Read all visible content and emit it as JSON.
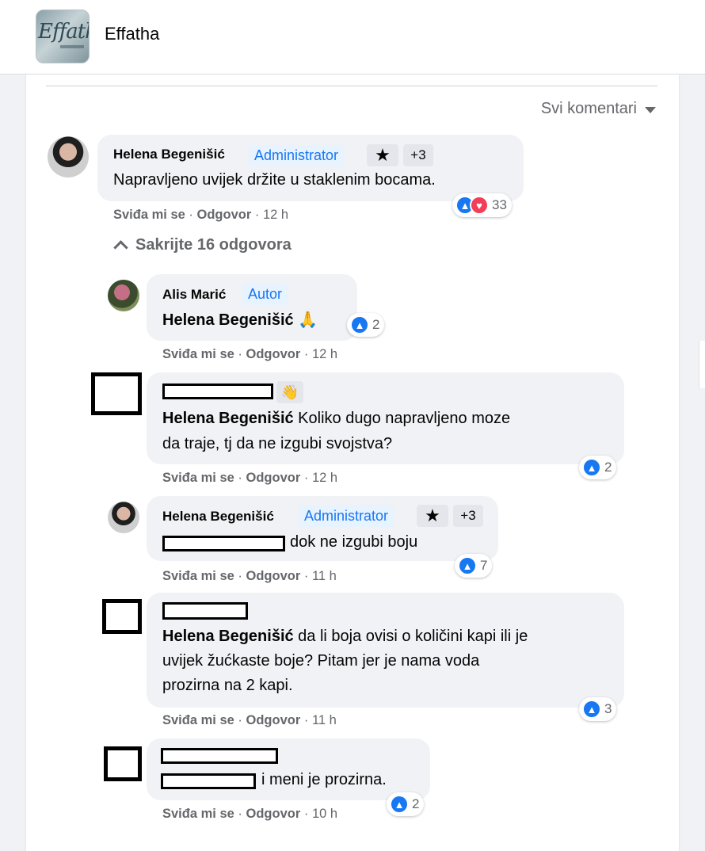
{
  "page": {
    "name": "Effatha",
    "logo_text": "Effatha"
  },
  "sort_label": "Svi komentari",
  "top_comment": {
    "author": "Helena Begenišić",
    "badge": "Administrator",
    "extra": "+3",
    "text": "Napravljeno uvijek držite u staklenim bocama.",
    "like": "Sviđa mi se",
    "reply": "Odgovor",
    "time": "12 h",
    "reactions": "33"
  },
  "toggle_label": "Sakrijte 16 odgovora",
  "replies": [
    {
      "author": "Alis Marić",
      "badge": "Autor",
      "mention": "Helena Begenišić",
      "text": "🙏",
      "like": "Sviđa mi se",
      "reply": "Odgovor",
      "time": "12 h",
      "reactions": "2"
    },
    {
      "author": "",
      "mention": "Helena Begenišić",
      "text": " Koliko dugo napravljeno moze",
      "text2": "da traje, tj da ne izgubi svojstva?",
      "like": "Sviđa mi se",
      "reply": "Odgovor",
      "time": "12 h",
      "reactions": "2"
    },
    {
      "author": "Helena Begenišić",
      "badge": "Administrator",
      "extra": "+3",
      "text": "dok ne izgubi boju",
      "like": "Sviđa mi se",
      "reply": "Odgovor",
      "time": "11 h",
      "reactions": "7"
    },
    {
      "author": "",
      "mention": "Helena Begenišić",
      "text": " da li boja ovisi o količini kapi ili je",
      "text2": "uvijek žućkaste boje? Pitam jer je nama voda",
      "text3": "prozirna na 2 kapi.",
      "like": "Sviđa mi se",
      "reply": "Odgovor",
      "time": "11 h",
      "reactions": "3"
    },
    {
      "author": "",
      "text": "i meni je prozirna.",
      "like": "Sviđa mi se",
      "reply": "Odgovor",
      "time": "10 h",
      "reactions": "2"
    }
  ],
  "sep": "·",
  "icons": {
    "like": "👍",
    "love": "♥",
    "star": "★",
    "wave": "👋",
    "pray": "🙏"
  }
}
